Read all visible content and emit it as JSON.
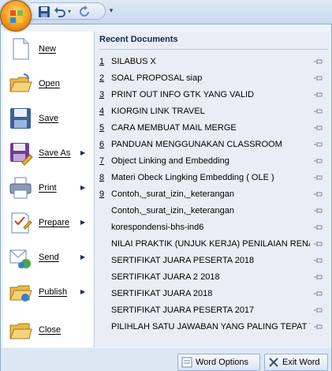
{
  "menu": {
    "left_items": [
      {
        "label": "New",
        "icon": "new-document-icon",
        "submenu": false
      },
      {
        "label": "Open",
        "icon": "open-folder-icon",
        "submenu": false
      },
      {
        "label": "Save",
        "icon": "save-disk-icon",
        "submenu": false
      },
      {
        "label": "Save As",
        "icon": "save-as-icon",
        "submenu": true
      },
      {
        "label": "Print",
        "icon": "printer-icon",
        "submenu": true
      },
      {
        "label": "Prepare",
        "icon": "prepare-icon",
        "submenu": true
      },
      {
        "label": "Send",
        "icon": "send-icon",
        "submenu": true
      },
      {
        "label": "Publish",
        "icon": "publish-icon",
        "submenu": true
      },
      {
        "label": "Close",
        "icon": "close-folder-icon",
        "submenu": false
      }
    ],
    "submenu_arrow": "▶"
  },
  "recent": {
    "header": "Recent Documents",
    "documents": [
      {
        "num": "1",
        "name": "SILABUS X"
      },
      {
        "num": "2",
        "name": "SOAL PROPOSAL siap"
      },
      {
        "num": "3",
        "name": "PRINT OUT INFO GTK YANG VALID"
      },
      {
        "num": "4",
        "name": "KIORGIN LINK TRAVEL"
      },
      {
        "num": "5",
        "name": "CARA MEMBUAT MAIL MERGE"
      },
      {
        "num": "6",
        "name": "PANDUAN MENGGUNAKAN CLASSROOM"
      },
      {
        "num": "7",
        "name": "Object Linking and Embedding"
      },
      {
        "num": "8",
        "name": "Materi Obeck Lingking Embedding ( OLE )"
      },
      {
        "num": "9",
        "name": "Contoh,_surat_izin,_keterangan"
      },
      {
        "num": "",
        "name": "Contoh,_surat_izin,_keterangan"
      },
      {
        "num": "",
        "name": "korespondensi-bhs-ind6"
      },
      {
        "num": "",
        "name": "NILAI PRAKTIK (UNJUK KERJA) PENILAIAN RENANG"
      },
      {
        "num": "",
        "name": "SERTIFIKAT JUARA PESERTA 2018"
      },
      {
        "num": "",
        "name": "SERTIFIKAT JUARA 2 2018"
      },
      {
        "num": "",
        "name": "SERTIFIKAT JUARA 2018"
      },
      {
        "num": "",
        "name": "SERTIFIKAT JUARA PESERTA 2017"
      },
      {
        "num": "",
        "name": "PILIHLAH SATU JAWABAN YANG PALING TEPAT T..."
      }
    ]
  },
  "footer": {
    "word_options_label": "Word Options",
    "exit_word_label": "Exit Word"
  },
  "colors": {
    "accent": "#f39a1c",
    "panel": "#eef3fa",
    "recent_bg": "#e9eef6"
  }
}
